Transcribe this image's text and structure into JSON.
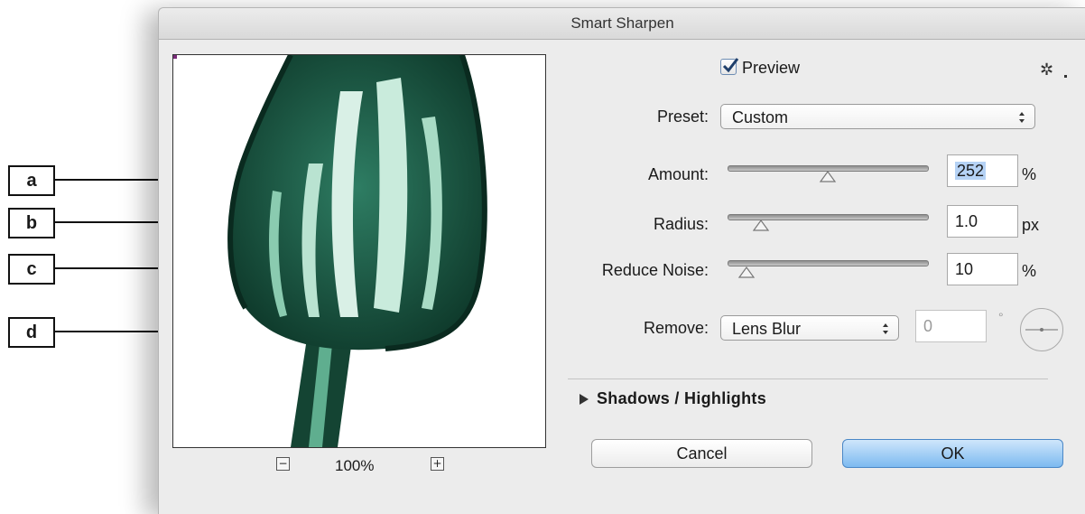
{
  "dialog": {
    "title": "Smart Sharpen",
    "preview_zoom": "100%",
    "preview": {
      "label": "Preview",
      "checked": true
    },
    "settings_icon": "gear-icon",
    "preset": {
      "label": "Preset:",
      "value": "Custom"
    },
    "amount": {
      "label": "Amount:",
      "value": "252",
      "unit": "%",
      "slider_fraction": 0.45
    },
    "radius": {
      "label": "Radius:",
      "value": "1.0",
      "unit": "px",
      "slider_fraction": 0.13
    },
    "reduce_noise": {
      "label": "Reduce Noise:",
      "value": "10",
      "unit": "%",
      "slider_fraction": 0.09
    },
    "remove": {
      "label": "Remove:",
      "value": "Lens Blur",
      "angle_value": "0",
      "angle_unit": "°"
    },
    "shadows_highlights": {
      "label": "Shadows / Highlights",
      "expanded": false
    },
    "buttons": {
      "cancel": "Cancel",
      "ok": "OK"
    }
  },
  "callouts": [
    "a",
    "b",
    "c",
    "d"
  ],
  "colors": {
    "dialog_bg": "#ececec",
    "ok_button": "#7cbaf0",
    "selection": "#b5d2f5",
    "preview_subject": "#1f5a45"
  }
}
